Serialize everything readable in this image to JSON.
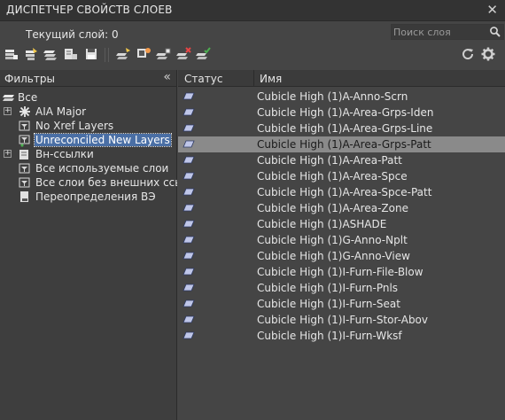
{
  "window": {
    "title": "ДИСПЕТЧЕР СВОЙСТВ СЛОЕВ",
    "close_glyph": "✕"
  },
  "current_layer": {
    "text": "Текущий слой: 0"
  },
  "search": {
    "placeholder": "Поиск слоя",
    "value": ""
  },
  "toolbar": {
    "buttons": [
      {
        "name": "new-property-filter-icon"
      },
      {
        "name": "new-group-filter-icon"
      },
      {
        "name": "layer-states-manager-icon"
      },
      {
        "name": "layer-walk-icon"
      },
      {
        "name": "save-icon"
      },
      {
        "name": "new-layer-icon"
      },
      {
        "name": "new-layer-vp-frozen-icon"
      },
      {
        "name": "new-layer-freeze-icon"
      },
      {
        "name": "delete-layer-icon"
      },
      {
        "name": "set-current-icon"
      }
    ],
    "refresh_icon": "refresh-icon",
    "settings_icon": "gear-icon"
  },
  "filters_panel": {
    "header": "Фильтры",
    "collapse_glyph": "«",
    "items": [
      {
        "label": "Все",
        "icon": "all-layers-icon",
        "level": 0,
        "expander": ""
      },
      {
        "label": "AIA Major",
        "icon": "group-filter-star-icon",
        "level": 1,
        "expander": "+"
      },
      {
        "label": "No Xref Layers",
        "icon": "property-filter-icon",
        "level": 1,
        "expander": ""
      },
      {
        "label": "Unreconciled New Layers",
        "icon": "unreconciled-filter-icon",
        "level": 1,
        "expander": "",
        "selected": true
      },
      {
        "label": "Вн-ссылки",
        "icon": "xref-filter-icon",
        "level": 1,
        "expander": "+"
      },
      {
        "label": "Все используемые слои",
        "icon": "property-filter-icon",
        "level": 1,
        "expander": ""
      },
      {
        "label": "Все слои без внешних ссылок",
        "icon": "property-filter-icon",
        "level": 1,
        "expander": ""
      },
      {
        "label": "Переопределения ВЭ",
        "icon": "viewport-override-icon",
        "level": 1,
        "expander": ""
      }
    ]
  },
  "layers_table": {
    "columns": [
      "Статус",
      "Имя"
    ],
    "rows": [
      {
        "name": "Cubicle High (1)A-Anno-Scrn"
      },
      {
        "name": "Cubicle High (1)A-Area-Grps-Iden"
      },
      {
        "name": "Cubicle High (1)A-Area-Grps-Line"
      },
      {
        "name": "Cubicle High (1)A-Area-Grps-Patt",
        "selected": true
      },
      {
        "name": "Cubicle High (1)A-Area-Patt"
      },
      {
        "name": "Cubicle High (1)A-Area-Spce"
      },
      {
        "name": "Cubicle High (1)A-Area-Spce-Patt"
      },
      {
        "name": "Cubicle High (1)A-Area-Zone"
      },
      {
        "name": "Cubicle High (1)ASHADE"
      },
      {
        "name": "Cubicle High (1)G-Anno-Nplt"
      },
      {
        "name": "Cubicle High (1)G-Anno-View"
      },
      {
        "name": "Cubicle High (1)I-Furn-File-Blow"
      },
      {
        "name": "Cubicle High (1)I-Furn-Pnls"
      },
      {
        "name": "Cubicle High (1)I-Furn-Seat"
      },
      {
        "name": "Cubicle High (1)I-Furn-Stor-Abov"
      },
      {
        "name": "Cubicle High (1)I-Furn-Wksf"
      }
    ]
  },
  "colors": {
    "background": "#454545",
    "selection_row": "#8a8a8a",
    "selection_label": "#4a6fa5",
    "status_icon": "#bfc6e8"
  }
}
